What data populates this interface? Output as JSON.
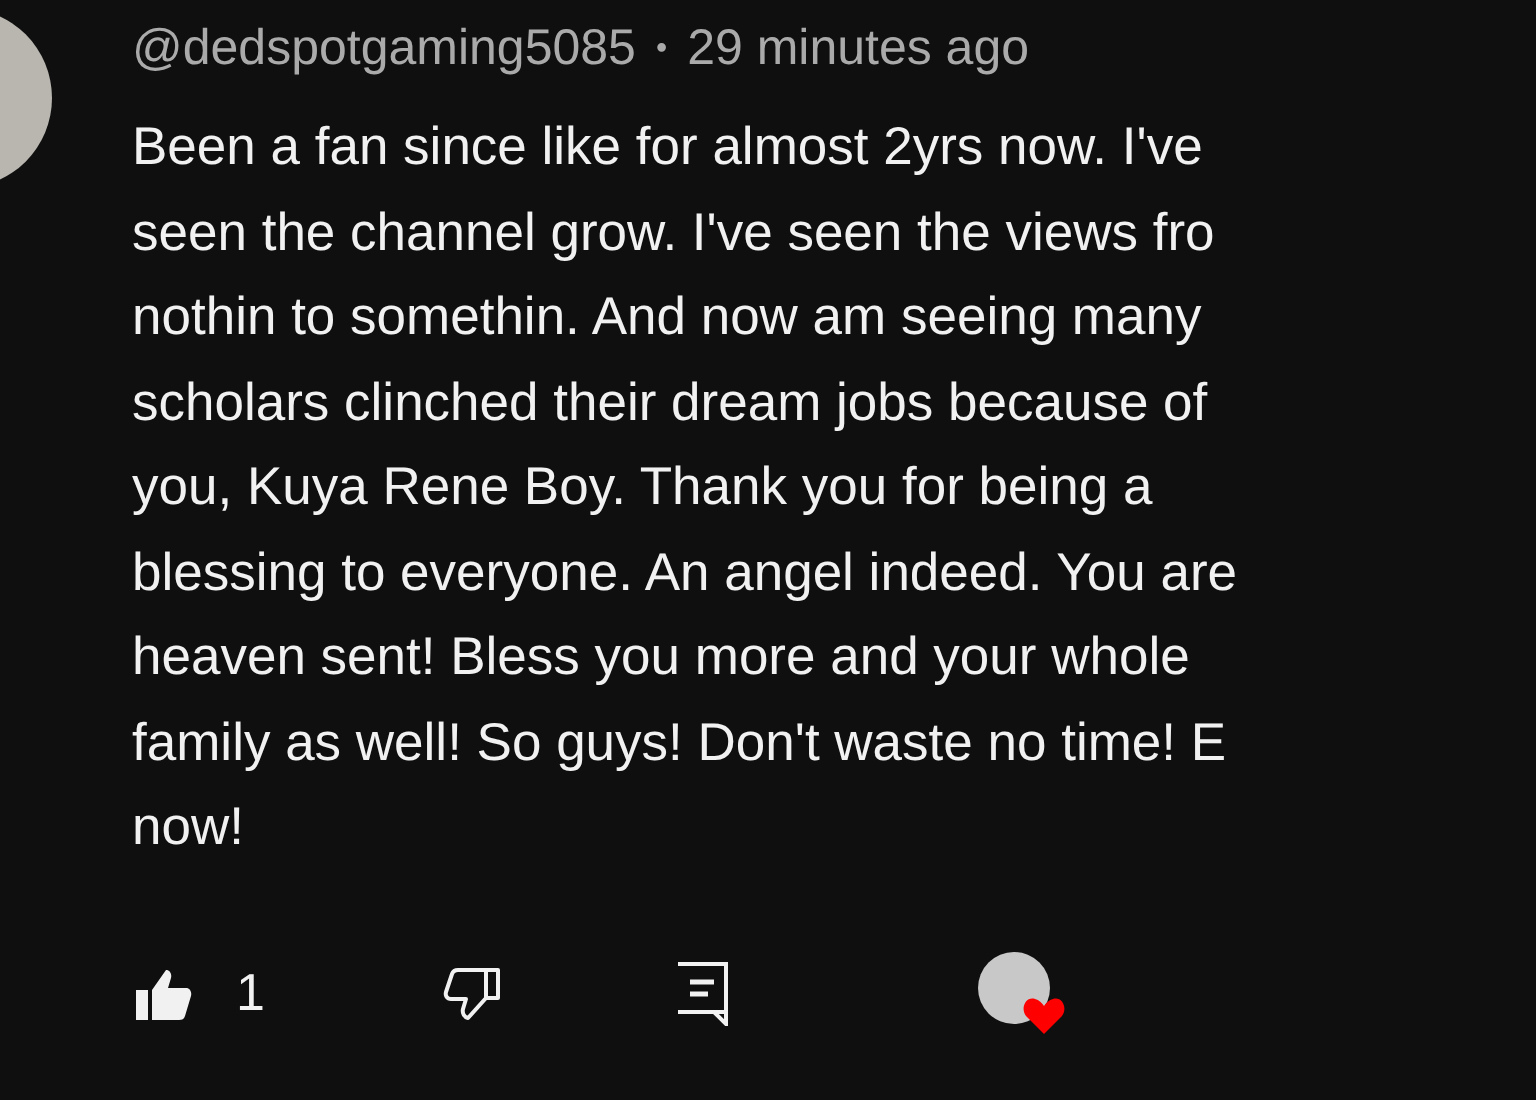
{
  "comment": {
    "author": "@dedspotgaming5085",
    "separator": "•",
    "time": "29 minutes ago",
    "lines": [
      "Been a fan since like for almost 2yrs now. I've",
      "seen the channel grow. I've seen the views fro",
      "nothin to somethin. And now am seeing many",
      "scholars clinched their dream jobs because of",
      "you, Kuya Rene Boy. Thank you for being a",
      "blessing to everyone. An angel indeed. You are",
      "heaven sent! Bless you more and your whole",
      "family as well! So guys! Don't waste no time! E",
      "now!"
    ],
    "liked": true,
    "like_count": "1",
    "hearted": true
  }
}
